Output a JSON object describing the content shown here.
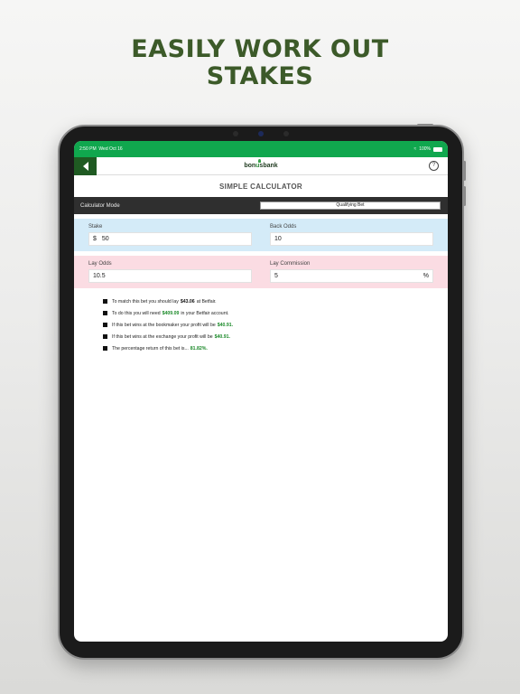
{
  "headline": {
    "line1": "EASILY WORK OUT",
    "line2": "STAKES"
  },
  "status_bar": {
    "time": "2:50 PM",
    "date": "Wed Oct 16",
    "battery": "100%"
  },
  "nav": {
    "logo_part1": "bon",
    "logo_part2": "u",
    "logo_part3": "s",
    "logo_part4": "bank",
    "help": "?"
  },
  "page_title": "SIMPLE CALCULATOR",
  "calculator_mode": {
    "label": "Calculator Mode",
    "selected": "Qualifying Bet"
  },
  "stake": {
    "label": "Stake",
    "prefix": "$",
    "value": "50"
  },
  "back_odds": {
    "label": "Back Odds",
    "value": "10"
  },
  "lay_odds": {
    "label": "Lay Odds",
    "value": "10.5"
  },
  "lay_commission": {
    "label": "Lay Commission",
    "value": "5",
    "suffix": "%"
  },
  "results": [
    {
      "before": "To match this bet you should lay",
      "value": "$43.06",
      "after": "at Betfair.",
      "color": "dark"
    },
    {
      "before": "To do this you will need",
      "value": "$409.09",
      "after": "in your Betfair account.",
      "color": "green"
    },
    {
      "before": "If this bet wins at the bookmaker your profit will be",
      "value": "$40.91.",
      "after": "",
      "color": "green"
    },
    {
      "before": "If this bet wins at the exchange your profit will be",
      "value": "$40.91.",
      "after": "",
      "color": "green"
    },
    {
      "before": "The percentage return of this bet is...",
      "value": "81.82%.",
      "after": "",
      "color": "green"
    }
  ],
  "colors": {
    "brand_green": "#10a74e",
    "headline": "#3c5a29",
    "stake_panel": "#d4ebf8",
    "lay_panel": "#fbdce3"
  }
}
